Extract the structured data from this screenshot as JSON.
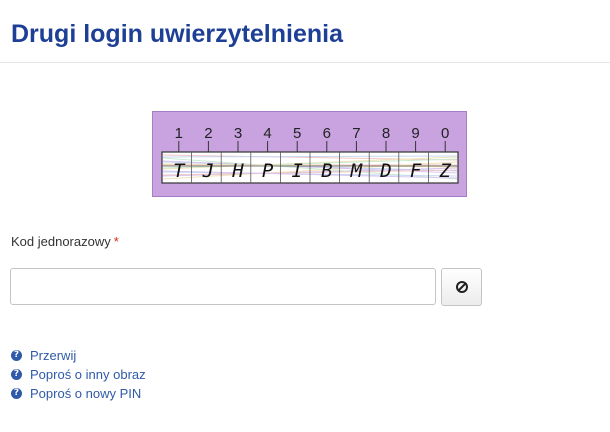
{
  "page": {
    "title": "Drugi login uwierzytelnienia"
  },
  "captcha": {
    "numbers": [
      "1",
      "2",
      "3",
      "4",
      "5",
      "6",
      "7",
      "8",
      "9",
      "0"
    ],
    "characters": [
      "T",
      "J",
      "H",
      "P",
      "I",
      "B",
      "M",
      "D",
      "F",
      "Z"
    ],
    "background_color": "#c9a3e0"
  },
  "form": {
    "code_label": "Kod jednorazowy",
    "required_marker": "*",
    "code_value": "",
    "code_placeholder": "",
    "clear_icon": "ban-icon"
  },
  "links": [
    {
      "icon": "question-icon",
      "label": "Przerwij"
    },
    {
      "icon": "question-icon",
      "label": "Poproś o inny obraz"
    },
    {
      "icon": "question-icon",
      "label": "Poproś o nowy PIN"
    }
  ],
  "colors": {
    "title": "#1d3f95",
    "link": "#2f5aa8",
    "required": "#d9261c"
  }
}
